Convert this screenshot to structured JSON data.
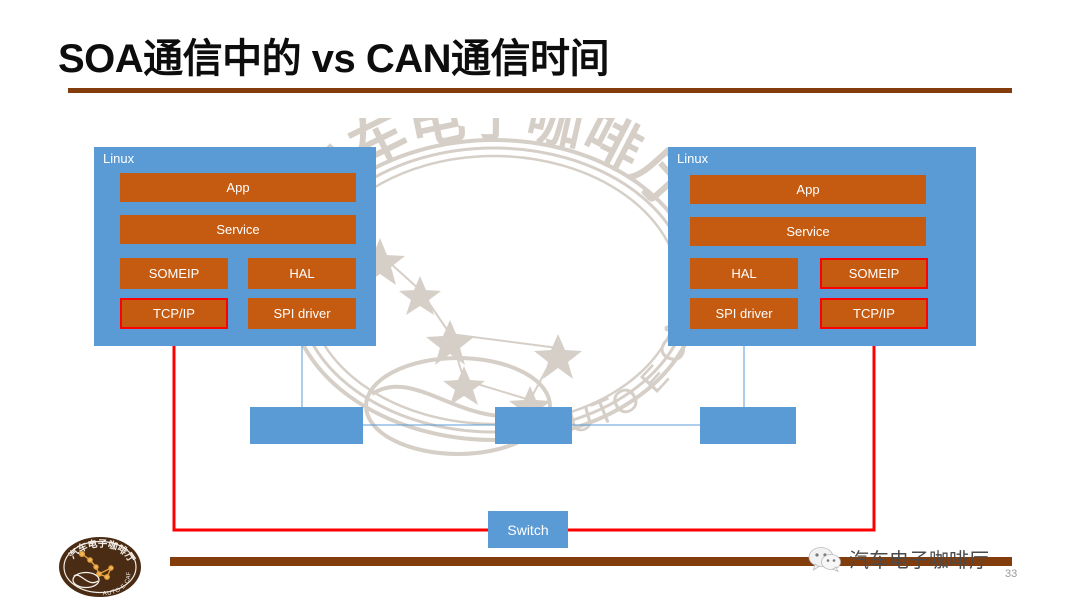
{
  "slide": {
    "title": "SOA通信中的 vs CAN通信时间",
    "page_number": "33"
  },
  "colors": {
    "panel_blue": "#5B9BD5",
    "layer_orange": "#C55A11",
    "highlight_red": "#FF0000",
    "rule_brown": "#833C0B",
    "link_blue": "#5B9BD5",
    "title_black": "#0D0D0D"
  },
  "nodes": {
    "left": {
      "label": "Linux",
      "layers": [
        {
          "text": "App",
          "highlighted": false
        },
        {
          "text": "Service",
          "highlighted": false
        },
        {
          "text": "SOMEIP",
          "highlighted": false
        },
        {
          "text": "HAL",
          "highlighted": false
        },
        {
          "text": "TCP/IP",
          "highlighted": true
        },
        {
          "text": "SPI driver",
          "highlighted": false
        }
      ]
    },
    "right": {
      "label": "Linux",
      "layers": [
        {
          "text": "App",
          "highlighted": false
        },
        {
          "text": "Service",
          "highlighted": false
        },
        {
          "text": "HAL",
          "highlighted": false
        },
        {
          "text": "SOMEIP",
          "highlighted": true
        },
        {
          "text": "SPI driver",
          "highlighted": false
        },
        {
          "text": "TCP/IP",
          "highlighted": true
        }
      ]
    }
  },
  "bus": {
    "boxes": [
      {
        "label": ""
      },
      {
        "label": ""
      },
      {
        "label": ""
      }
    ]
  },
  "switch": {
    "label": "Switch"
  },
  "watermark": {
    "arc_text": "汽车电子咖啡厅",
    "sub_text": "AUTO E CAFE"
  },
  "footer": {
    "logo_arc_text": "汽车电子咖啡厅",
    "logo_sub_text": "AUTO E CAFE",
    "wechat_label": "汽车电子咖啡厅",
    "wechat_icon": "wechat-icon"
  }
}
